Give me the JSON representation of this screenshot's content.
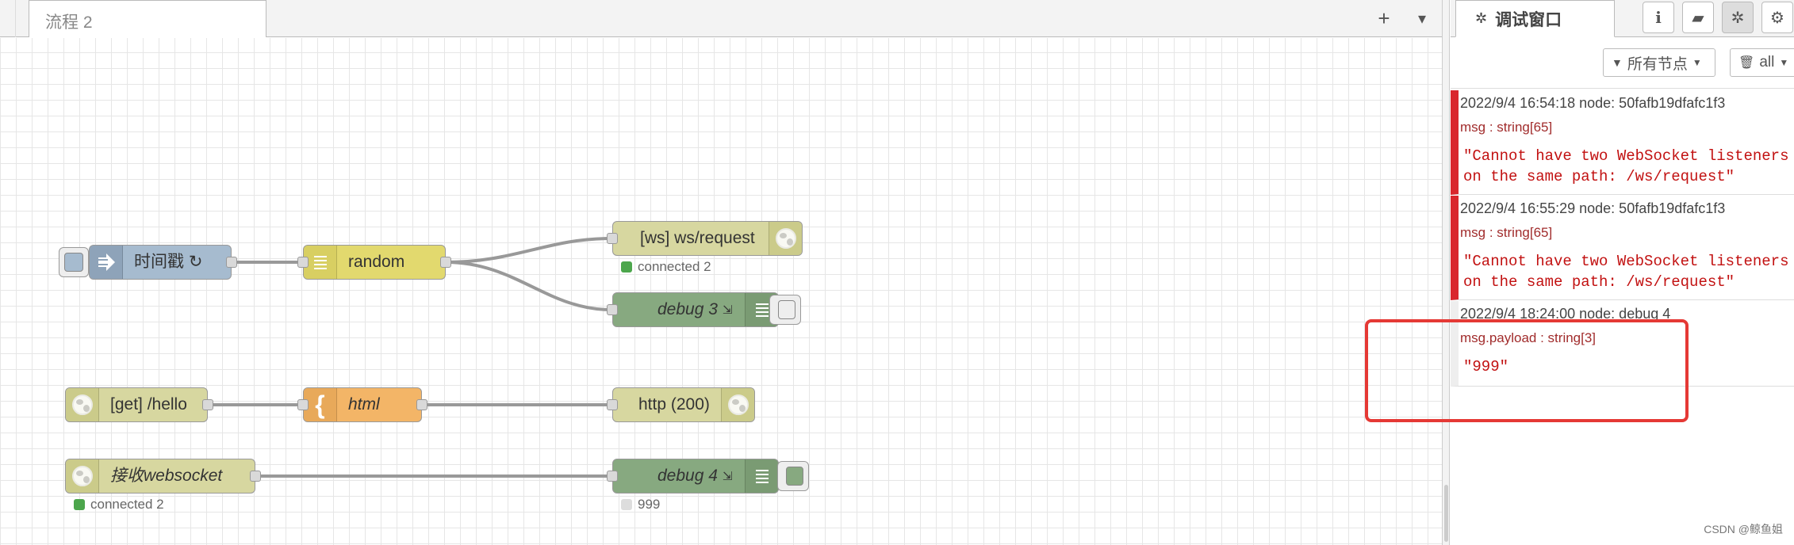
{
  "workspace": {
    "tab_label": "流程 2",
    "add_flow_label": "+",
    "flow_menu_label": "▾"
  },
  "nodes": {
    "inject": {
      "label": "时间戳 ↻",
      "color": "#a6bbcf"
    },
    "random": {
      "label": "random",
      "color": "#e2d96e"
    },
    "ws_request": {
      "label": "[ws] ws/request",
      "color": "#d7d7a0",
      "status": "connected 2",
      "status_color": "#4ca64c"
    },
    "debug3": {
      "label": "debug 3",
      "color": "#87a980"
    },
    "get_hello": {
      "label": "[get] /hello",
      "color": "#d7d7a0"
    },
    "html": {
      "label": "html",
      "color": "#f3b567"
    },
    "http_response": {
      "label": "http (200)",
      "color": "#d7d7a0"
    },
    "ws_receive": {
      "label": "接收websocket",
      "color": "#d7d7a0",
      "status": "connected 2",
      "status_color": "#4ca64c"
    },
    "debug4": {
      "label": "debug 4",
      "color": "#87a980",
      "status": "999",
      "status_color": "#ddd"
    }
  },
  "sidebar": {
    "title": "调试窗口",
    "filter_label": "所有节点",
    "clear_label": "all",
    "messages": [
      {
        "meta": "2022/9/4 16:54:18   node: 50fafb19dfafc1f3",
        "type": "msg : string[65]",
        "value": "\"Cannot have two WebSocket listeners\non the same path: /ws/request\""
      },
      {
        "meta": "2022/9/4 16:55:29   node: 50fafb19dfafc1f3",
        "type": "msg : string[65]",
        "value": "\"Cannot have two WebSocket listeners\non the same path: /ws/request\""
      },
      {
        "meta": "2022/9/4 18:24:00   node: debug 4",
        "type": "msg.payload : string[3]",
        "value": "\"999\""
      }
    ]
  },
  "watermark": "CSDN @鲸鱼姐"
}
